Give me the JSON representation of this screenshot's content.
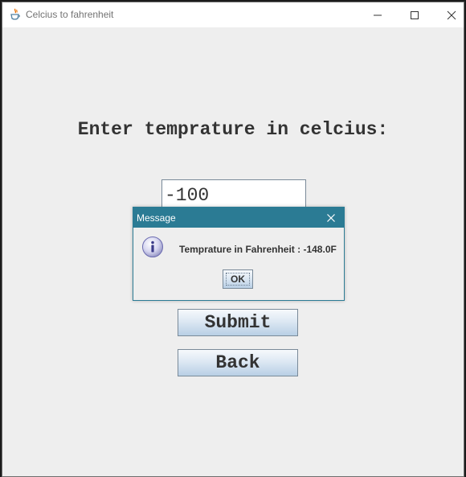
{
  "window": {
    "title": "Celcius to fahrenheit",
    "icon": "java-coffee-icon"
  },
  "main": {
    "prompt": "Enter temprature in celcius:",
    "input_value": "-100",
    "submit_label": "Submit",
    "back_label": "Back"
  },
  "dialog": {
    "title": "Message",
    "icon": "info-icon",
    "message": "Temprature in Fahrenheit : -148.0F",
    "ok_label": "OK"
  },
  "colors": {
    "dialog_titlebar": "#2b7b94",
    "window_background": "#eeeeee",
    "button_gradient_top": "#f6f9fc",
    "button_gradient_bottom": "#b8cfe5"
  }
}
